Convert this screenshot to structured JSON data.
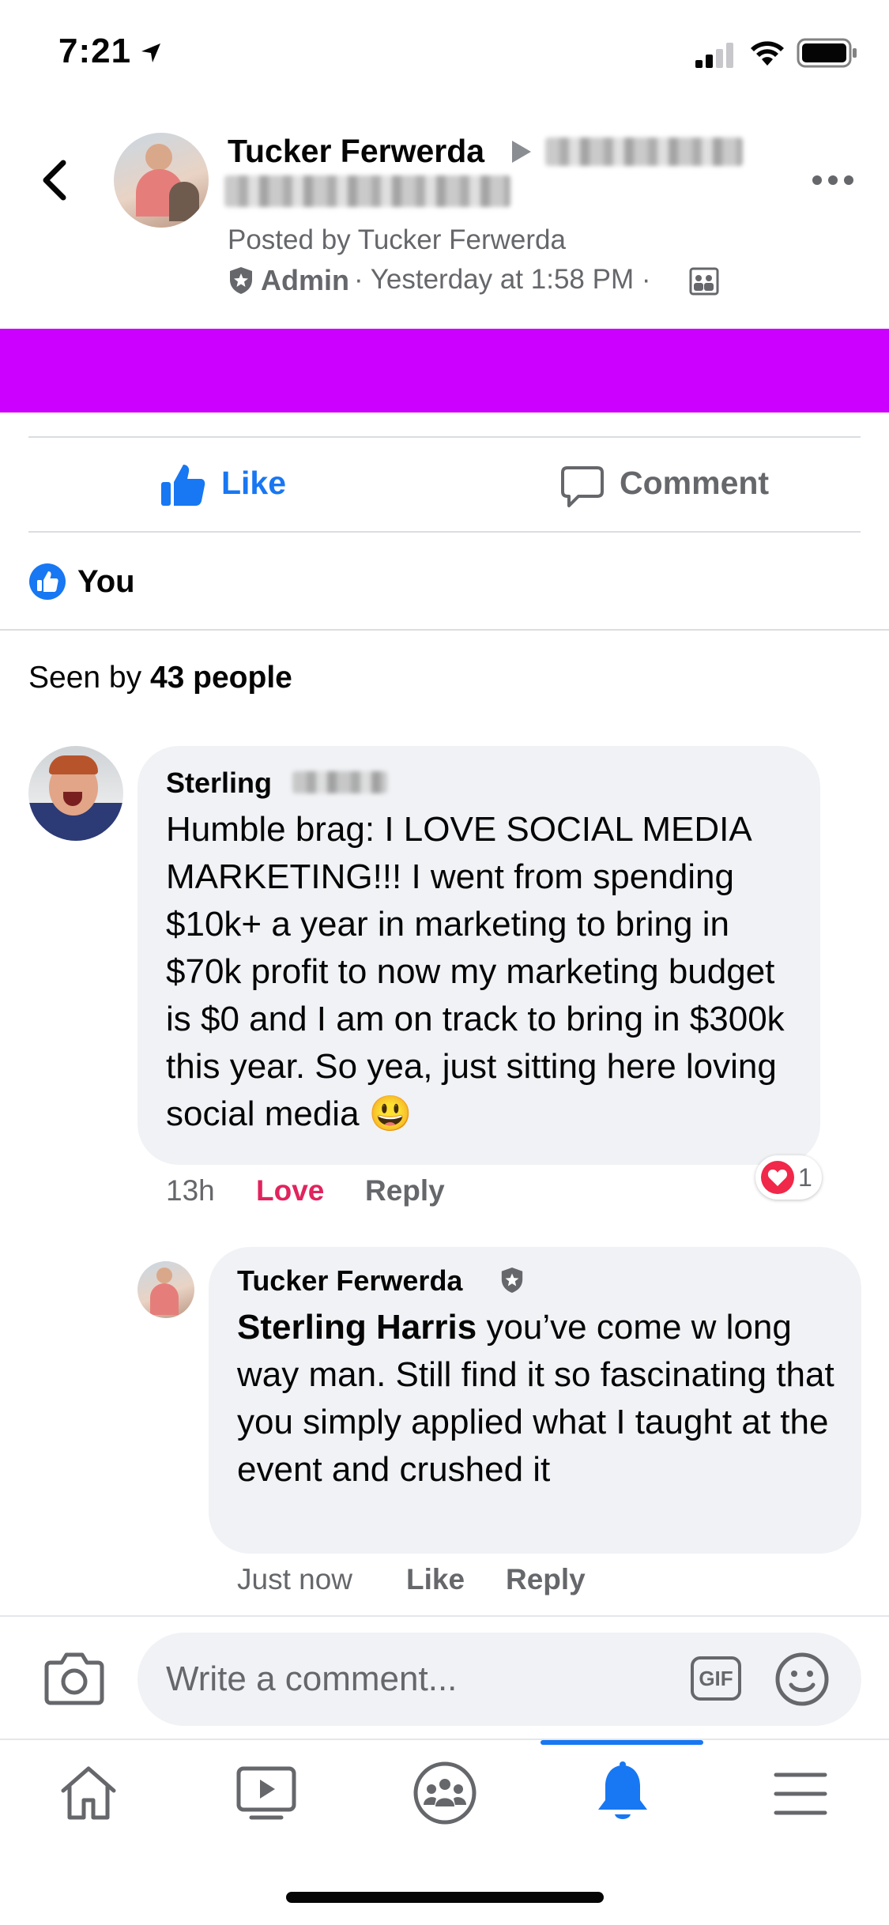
{
  "status_bar": {
    "time": "7:21"
  },
  "post": {
    "author": "Tucker Ferwerda",
    "posted_by": "Posted by Tucker Ferwerda",
    "role": "Admin",
    "timestamp": "· Yesterday at 1:58 PM ·",
    "banner_color": "#cc00ff"
  },
  "actions": {
    "like": "Like",
    "comment": "Comment"
  },
  "reactions": {
    "you": "You"
  },
  "seen": {
    "prefix": "Seen by ",
    "count": "43 people"
  },
  "comments": [
    {
      "author": "Sterling",
      "text": "Humble brag: I LOVE SOCIAL MEDIA MARKETING!!! I went from spending $10k+ a year in marketing to bring in $70k profit to now my marketing budget is $0 and I am on track to bring in $300k this year. So yea, just sitting here loving social media 😃",
      "time": "13h",
      "reaction_label": "Love",
      "reply_label": "Reply",
      "reaction_count": "1"
    }
  ],
  "reply": {
    "author": "Tucker Ferwerda",
    "mention": "Sterling Harris",
    "text": " you’ve come w long way man. Still find it so fascinating that you simply applied what I taught at the event and crushed it",
    "time": "Just now",
    "like_label": "Like",
    "reply_label": "Reply"
  },
  "composer": {
    "placeholder": "Write a comment...",
    "gif_label": "GIF"
  },
  "colors": {
    "accent": "#1877f2",
    "love": "#e0245e",
    "banner": "#cc00ff"
  },
  "tab_bar": {
    "tabs": [
      "home-icon",
      "video-icon",
      "groups-icon",
      "notifications-icon",
      "menu-icon"
    ],
    "active": "notifications-icon"
  }
}
